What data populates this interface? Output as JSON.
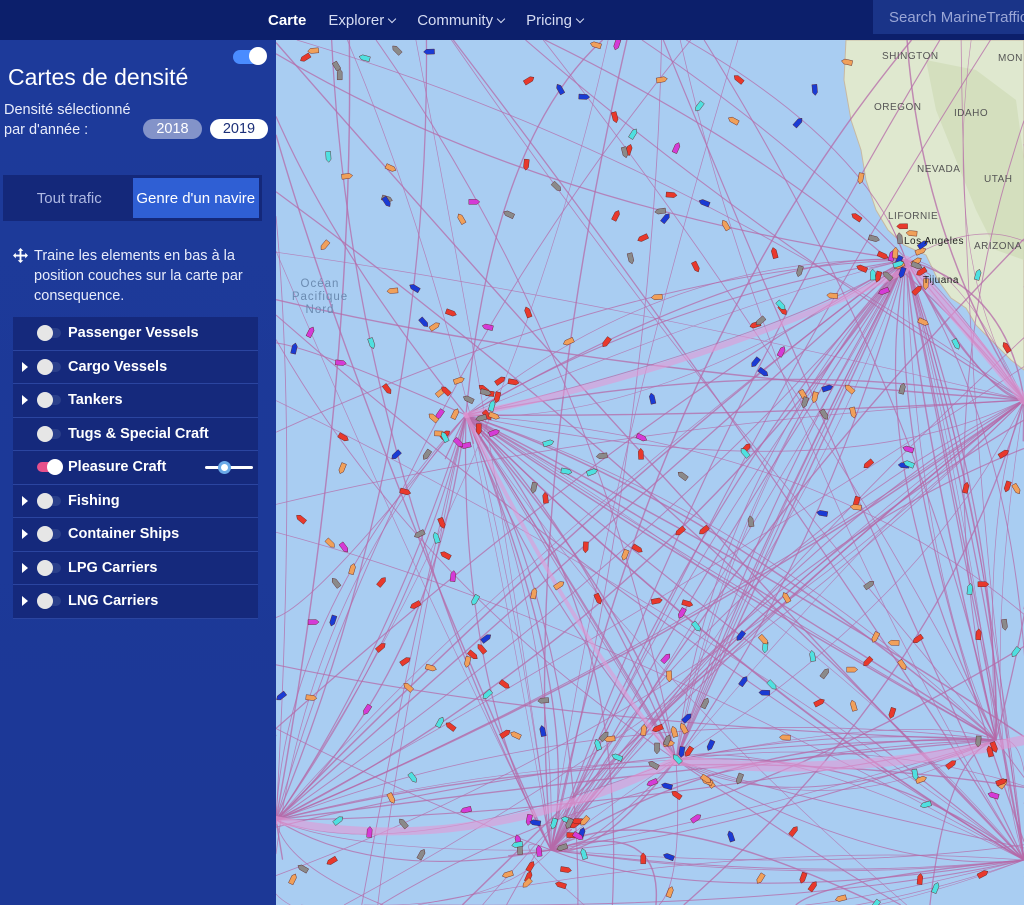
{
  "nav": {
    "items": [
      {
        "label": "Carte",
        "active": true,
        "dropdown": false
      },
      {
        "label": "Explorer",
        "active": false,
        "dropdown": true
      },
      {
        "label": "Community",
        "active": false,
        "dropdown": true
      },
      {
        "label": "Pricing",
        "active": false,
        "dropdown": true
      }
    ],
    "search_placeholder": "Search MarineTraffic"
  },
  "sidebar": {
    "title": "Cartes de densité",
    "year_label": "Densité sélectionné par d'année :",
    "years": [
      "2018",
      "2019"
    ],
    "selected_year": "2019",
    "tabs": [
      "Tout trafic",
      "Genre d'un navire"
    ],
    "selected_tab": "Genre d'un navire",
    "hint": "Traine les elements en bas à la position couches sur la carte par consequence.",
    "layers": [
      {
        "label": "Passenger Vessels",
        "expandable": false,
        "on": false
      },
      {
        "label": "Cargo Vessels",
        "expandable": true,
        "on": false
      },
      {
        "label": "Tankers",
        "expandable": true,
        "on": false
      },
      {
        "label": "Tugs & Special Craft",
        "expandable": false,
        "on": false
      },
      {
        "label": "Pleasure Craft",
        "expandable": false,
        "on": true,
        "opacity": 0.6
      },
      {
        "label": "Fishing",
        "expandable": true,
        "on": false
      },
      {
        "label": "Container Ships",
        "expandable": true,
        "on": false
      },
      {
        "label": "LPG Carriers",
        "expandable": true,
        "on": false
      },
      {
        "label": "LNG Carriers",
        "expandable": true,
        "on": false
      }
    ]
  },
  "map": {
    "ocean_label": "Océan Pacifique Nord",
    "land_labels": [
      "SHINGTON",
      "MON",
      "OREGON",
      "IDAHO",
      "NEVADA",
      "UTAH",
      "LIFORNIE",
      "Los Angeles",
      "ARIZONA",
      "Tijuana"
    ],
    "colors": {
      "ocean": "#a9cdf2",
      "track": "#b56aa8",
      "land": "#dfe8cf"
    }
  }
}
